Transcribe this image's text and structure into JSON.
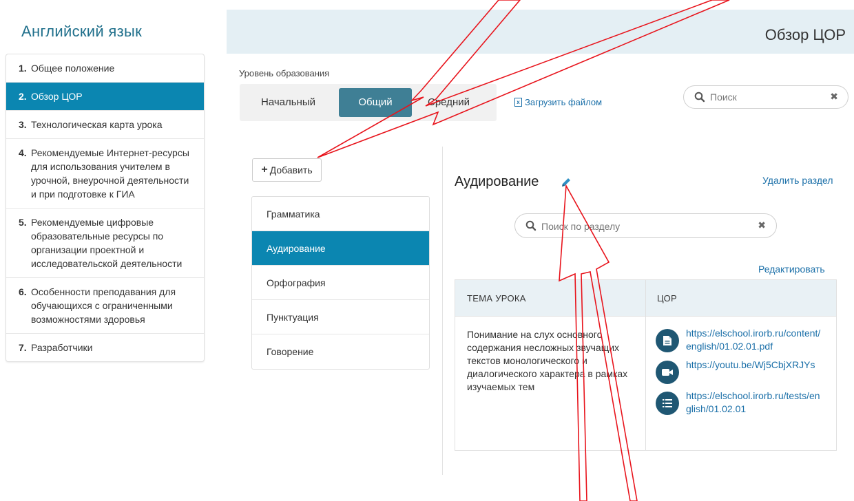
{
  "app": {
    "title": "Английский язык"
  },
  "sidebar": {
    "items": [
      {
        "num": "1.",
        "label": "Общее положение"
      },
      {
        "num": "2.",
        "label": "Обзор ЦОР"
      },
      {
        "num": "3.",
        "label": "Технологическая карта урока"
      },
      {
        "num": "4.",
        "label": "Рекомендуемые Интернет-ресурсы для использования учителем в урочной, внеурочной деятельности и при подготовке к ГИА"
      },
      {
        "num": "5.",
        "label": "Рекомендуемые цифровые образовательные ресурсы по организации проектной и исследовательской деятельности"
      },
      {
        "num": "6.",
        "label": "Особенности преподавания для обучающихся с ограниченными возможностями здоровья"
      },
      {
        "num": "7.",
        "label": "Разработчики"
      }
    ],
    "active_index": 1
  },
  "header": {
    "title": "Обзор ЦОР"
  },
  "level": {
    "label": "Уровень образования",
    "tabs": [
      "Начальный",
      "Общий",
      "Средний"
    ],
    "active": "Общий"
  },
  "upload": {
    "label": "Загрузить файлом",
    "icon": "excel-file-icon"
  },
  "search": {
    "placeholder": "Поиск",
    "icon": "search-icon",
    "clear_icon": "close-icon"
  },
  "add_button": {
    "label": "Добавить",
    "icon": "plus-icon"
  },
  "sections": {
    "items": [
      "Грамматика",
      "Аудирование",
      "Орфография",
      "Пунктуация",
      "Говорение"
    ],
    "active": "Аудирование"
  },
  "section": {
    "title": "Аудирование",
    "edit_icon": "pencil-icon",
    "delete_label": "Удалить раздел",
    "search_placeholder": "Поиск по разделу",
    "edit_label": "Редактировать"
  },
  "table": {
    "headers": [
      "ТЕМА УРОКА",
      "ЦОР"
    ],
    "rows": [
      {
        "topic": "Понимание на слух основного содержания несложных звучащих текстов монологического и диалогического характера в рамках изучаемых тем",
        "resources": [
          {
            "icon": "document-icon",
            "url": "https://elschool.irorb.ru/content/english/01.02.01.pdf"
          },
          {
            "icon": "video-camera-icon",
            "url": "https://youtu.be/Wj5CbjXRJYs"
          },
          {
            "icon": "numbered-list-icon",
            "url": "https://elschool.irorb.ru/tests/english/01.02.01"
          }
        ]
      }
    ]
  },
  "colors": {
    "primary": "#0b86b1",
    "tab_active": "#3f7f95",
    "header_bg": "#e4eff4",
    "link": "#1a6fa8",
    "resource_icon_bg": "#1f5773",
    "annotation_arrow": "#e8141c"
  }
}
